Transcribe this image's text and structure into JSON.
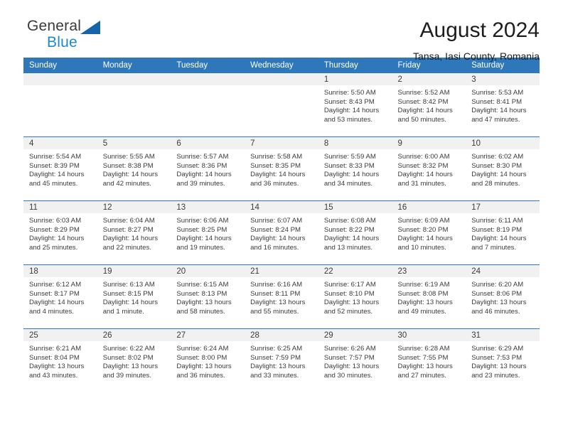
{
  "brand": {
    "name_top": "General",
    "name_bottom": "Blue",
    "triangle_color": "#1565a8",
    "blue_color": "#1f86d0"
  },
  "header": {
    "title": "August 2024",
    "subtitle": "Tansa, Iasi County, Romania"
  },
  "theme": {
    "header_row_bg": "#2f77bb",
    "daynum_bg": "#f1f1f1",
    "text_color": "#3b3b3b"
  },
  "weekday_headers": [
    "Sunday",
    "Monday",
    "Tuesday",
    "Wednesday",
    "Thursday",
    "Friday",
    "Saturday"
  ],
  "labels": {
    "sunrise_prefix": "Sunrise:",
    "sunset_prefix": "Sunset:",
    "daylight_prefix": "Daylight:"
  },
  "weeks": [
    [
      {
        "day": "",
        "line1": "",
        "line2": "",
        "line3": "",
        "line4": "",
        "empty": true
      },
      {
        "day": "",
        "line1": "",
        "line2": "",
        "line3": "",
        "line4": "",
        "empty": true
      },
      {
        "day": "",
        "line1": "",
        "line2": "",
        "line3": "",
        "line4": "",
        "empty": true
      },
      {
        "day": "",
        "line1": "",
        "line2": "",
        "line3": "",
        "line4": "",
        "empty": true
      },
      {
        "day": "1",
        "line1": "Sunrise: 5:50 AM",
        "line2": "Sunset: 8:43 PM",
        "line3": "Daylight: 14 hours",
        "line4": "and 53 minutes.",
        "empty": false
      },
      {
        "day": "2",
        "line1": "Sunrise: 5:52 AM",
        "line2": "Sunset: 8:42 PM",
        "line3": "Daylight: 14 hours",
        "line4": "and 50 minutes.",
        "empty": false
      },
      {
        "day": "3",
        "line1": "Sunrise: 5:53 AM",
        "line2": "Sunset: 8:41 PM",
        "line3": "Daylight: 14 hours",
        "line4": "and 47 minutes.",
        "empty": false
      }
    ],
    [
      {
        "day": "4",
        "line1": "Sunrise: 5:54 AM",
        "line2": "Sunset: 8:39 PM",
        "line3": "Daylight: 14 hours",
        "line4": "and 45 minutes.",
        "empty": false
      },
      {
        "day": "5",
        "line1": "Sunrise: 5:55 AM",
        "line2": "Sunset: 8:38 PM",
        "line3": "Daylight: 14 hours",
        "line4": "and 42 minutes.",
        "empty": false
      },
      {
        "day": "6",
        "line1": "Sunrise: 5:57 AM",
        "line2": "Sunset: 8:36 PM",
        "line3": "Daylight: 14 hours",
        "line4": "and 39 minutes.",
        "empty": false
      },
      {
        "day": "7",
        "line1": "Sunrise: 5:58 AM",
        "line2": "Sunset: 8:35 PM",
        "line3": "Daylight: 14 hours",
        "line4": "and 36 minutes.",
        "empty": false
      },
      {
        "day": "8",
        "line1": "Sunrise: 5:59 AM",
        "line2": "Sunset: 8:33 PM",
        "line3": "Daylight: 14 hours",
        "line4": "and 34 minutes.",
        "empty": false
      },
      {
        "day": "9",
        "line1": "Sunrise: 6:00 AM",
        "line2": "Sunset: 8:32 PM",
        "line3": "Daylight: 14 hours",
        "line4": "and 31 minutes.",
        "empty": false
      },
      {
        "day": "10",
        "line1": "Sunrise: 6:02 AM",
        "line2": "Sunset: 8:30 PM",
        "line3": "Daylight: 14 hours",
        "line4": "and 28 minutes.",
        "empty": false
      }
    ],
    [
      {
        "day": "11",
        "line1": "Sunrise: 6:03 AM",
        "line2": "Sunset: 8:29 PM",
        "line3": "Daylight: 14 hours",
        "line4": "and 25 minutes.",
        "empty": false
      },
      {
        "day": "12",
        "line1": "Sunrise: 6:04 AM",
        "line2": "Sunset: 8:27 PM",
        "line3": "Daylight: 14 hours",
        "line4": "and 22 minutes.",
        "empty": false
      },
      {
        "day": "13",
        "line1": "Sunrise: 6:06 AM",
        "line2": "Sunset: 8:25 PM",
        "line3": "Daylight: 14 hours",
        "line4": "and 19 minutes.",
        "empty": false
      },
      {
        "day": "14",
        "line1": "Sunrise: 6:07 AM",
        "line2": "Sunset: 8:24 PM",
        "line3": "Daylight: 14 hours",
        "line4": "and 16 minutes.",
        "empty": false
      },
      {
        "day": "15",
        "line1": "Sunrise: 6:08 AM",
        "line2": "Sunset: 8:22 PM",
        "line3": "Daylight: 14 hours",
        "line4": "and 13 minutes.",
        "empty": false
      },
      {
        "day": "16",
        "line1": "Sunrise: 6:09 AM",
        "line2": "Sunset: 8:20 PM",
        "line3": "Daylight: 14 hours",
        "line4": "and 10 minutes.",
        "empty": false
      },
      {
        "day": "17",
        "line1": "Sunrise: 6:11 AM",
        "line2": "Sunset: 8:19 PM",
        "line3": "Daylight: 14 hours",
        "line4": "and 7 minutes.",
        "empty": false
      }
    ],
    [
      {
        "day": "18",
        "line1": "Sunrise: 6:12 AM",
        "line2": "Sunset: 8:17 PM",
        "line3": "Daylight: 14 hours",
        "line4": "and 4 minutes.",
        "empty": false
      },
      {
        "day": "19",
        "line1": "Sunrise: 6:13 AM",
        "line2": "Sunset: 8:15 PM",
        "line3": "Daylight: 14 hours",
        "line4": "and 1 minute.",
        "empty": false
      },
      {
        "day": "20",
        "line1": "Sunrise: 6:15 AM",
        "line2": "Sunset: 8:13 PM",
        "line3": "Daylight: 13 hours",
        "line4": "and 58 minutes.",
        "empty": false
      },
      {
        "day": "21",
        "line1": "Sunrise: 6:16 AM",
        "line2": "Sunset: 8:11 PM",
        "line3": "Daylight: 13 hours",
        "line4": "and 55 minutes.",
        "empty": false
      },
      {
        "day": "22",
        "line1": "Sunrise: 6:17 AM",
        "line2": "Sunset: 8:10 PM",
        "line3": "Daylight: 13 hours",
        "line4": "and 52 minutes.",
        "empty": false
      },
      {
        "day": "23",
        "line1": "Sunrise: 6:19 AM",
        "line2": "Sunset: 8:08 PM",
        "line3": "Daylight: 13 hours",
        "line4": "and 49 minutes.",
        "empty": false
      },
      {
        "day": "24",
        "line1": "Sunrise: 6:20 AM",
        "line2": "Sunset: 8:06 PM",
        "line3": "Daylight: 13 hours",
        "line4": "and 46 minutes.",
        "empty": false
      }
    ],
    [
      {
        "day": "25",
        "line1": "Sunrise: 6:21 AM",
        "line2": "Sunset: 8:04 PM",
        "line3": "Daylight: 13 hours",
        "line4": "and 43 minutes.",
        "empty": false
      },
      {
        "day": "26",
        "line1": "Sunrise: 6:22 AM",
        "line2": "Sunset: 8:02 PM",
        "line3": "Daylight: 13 hours",
        "line4": "and 39 minutes.",
        "empty": false
      },
      {
        "day": "27",
        "line1": "Sunrise: 6:24 AM",
        "line2": "Sunset: 8:00 PM",
        "line3": "Daylight: 13 hours",
        "line4": "and 36 minutes.",
        "empty": false
      },
      {
        "day": "28",
        "line1": "Sunrise: 6:25 AM",
        "line2": "Sunset: 7:59 PM",
        "line3": "Daylight: 13 hours",
        "line4": "and 33 minutes.",
        "empty": false
      },
      {
        "day": "29",
        "line1": "Sunrise: 6:26 AM",
        "line2": "Sunset: 7:57 PM",
        "line3": "Daylight: 13 hours",
        "line4": "and 30 minutes.",
        "empty": false
      },
      {
        "day": "30",
        "line1": "Sunrise: 6:28 AM",
        "line2": "Sunset: 7:55 PM",
        "line3": "Daylight: 13 hours",
        "line4": "and 27 minutes.",
        "empty": false
      },
      {
        "day": "31",
        "line1": "Sunrise: 6:29 AM",
        "line2": "Sunset: 7:53 PM",
        "line3": "Daylight: 13 hours",
        "line4": "and 23 minutes.",
        "empty": false
      }
    ]
  ]
}
